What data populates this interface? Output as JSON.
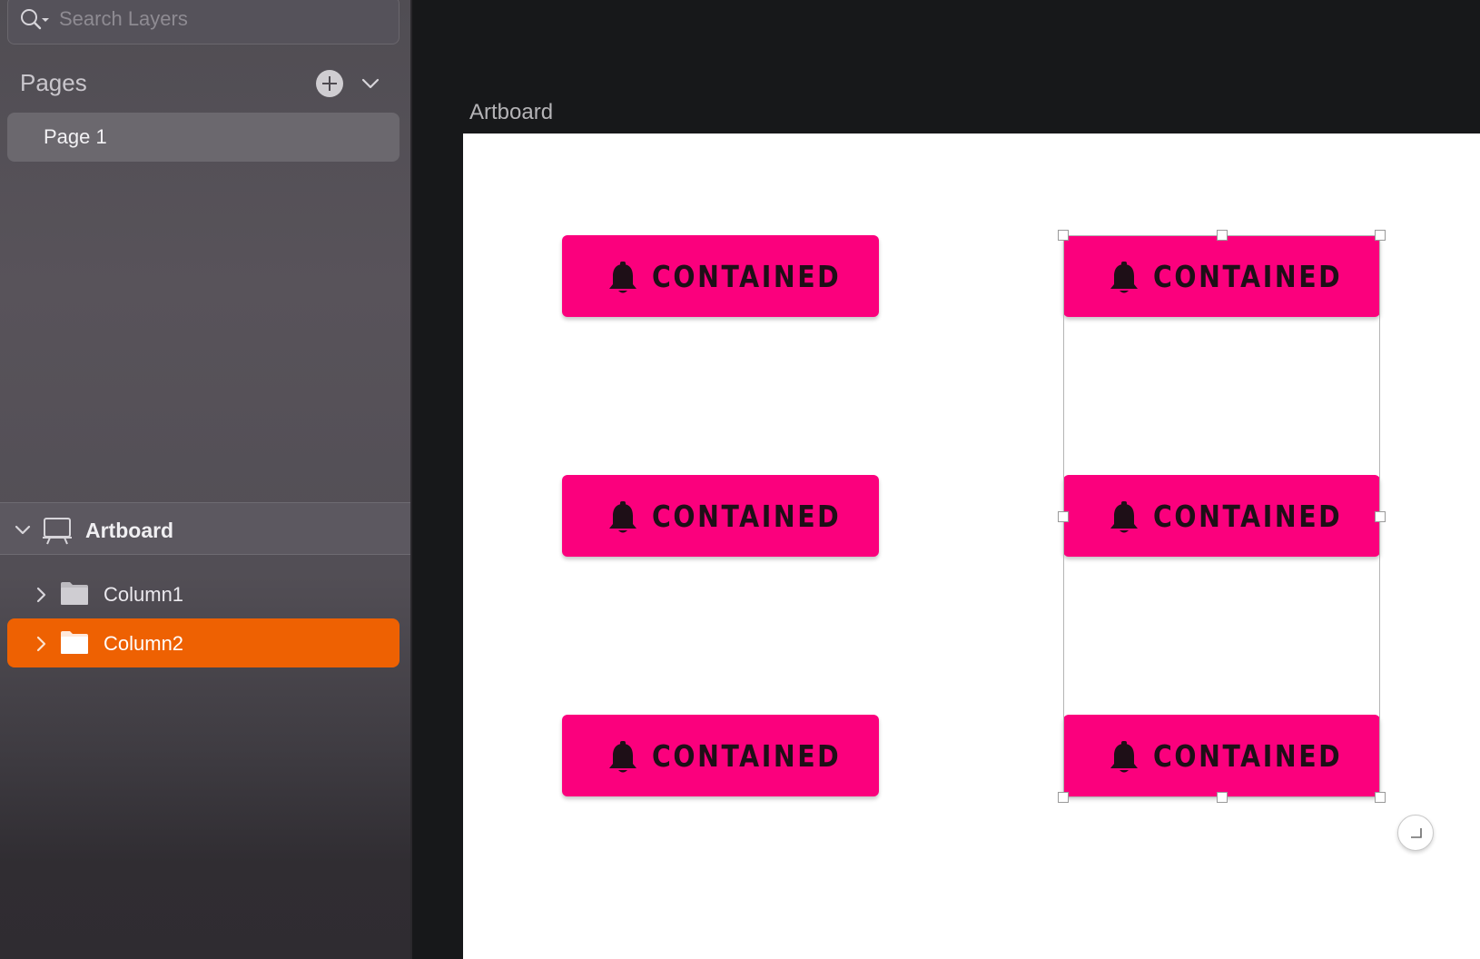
{
  "search": {
    "placeholder": "Search Layers"
  },
  "pages": {
    "title": "Pages",
    "items": [
      {
        "label": "Page 1"
      }
    ]
  },
  "layers": {
    "artboard_label": "Artboard",
    "items": [
      {
        "label": "Column1",
        "selected": false
      },
      {
        "label": "Column2",
        "selected": true
      }
    ]
  },
  "canvas": {
    "artboard_title": "Artboard",
    "buttons": {
      "col1": [
        "CONTAINED",
        "CONTAINED",
        "CONTAINED"
      ],
      "col2": [
        "CONTAINED",
        "CONTAINED",
        "CONTAINED"
      ]
    }
  },
  "colors": {
    "accent": "#ee6102",
    "button_bg": "#fb007d",
    "button_text": "#1e0f17"
  },
  "icons": [
    "search-icon",
    "add-page-icon",
    "chevron-down-icon",
    "artboard-icon",
    "chevron-right-icon",
    "folder-icon",
    "bell-icon",
    "resize-corner-icon"
  ]
}
